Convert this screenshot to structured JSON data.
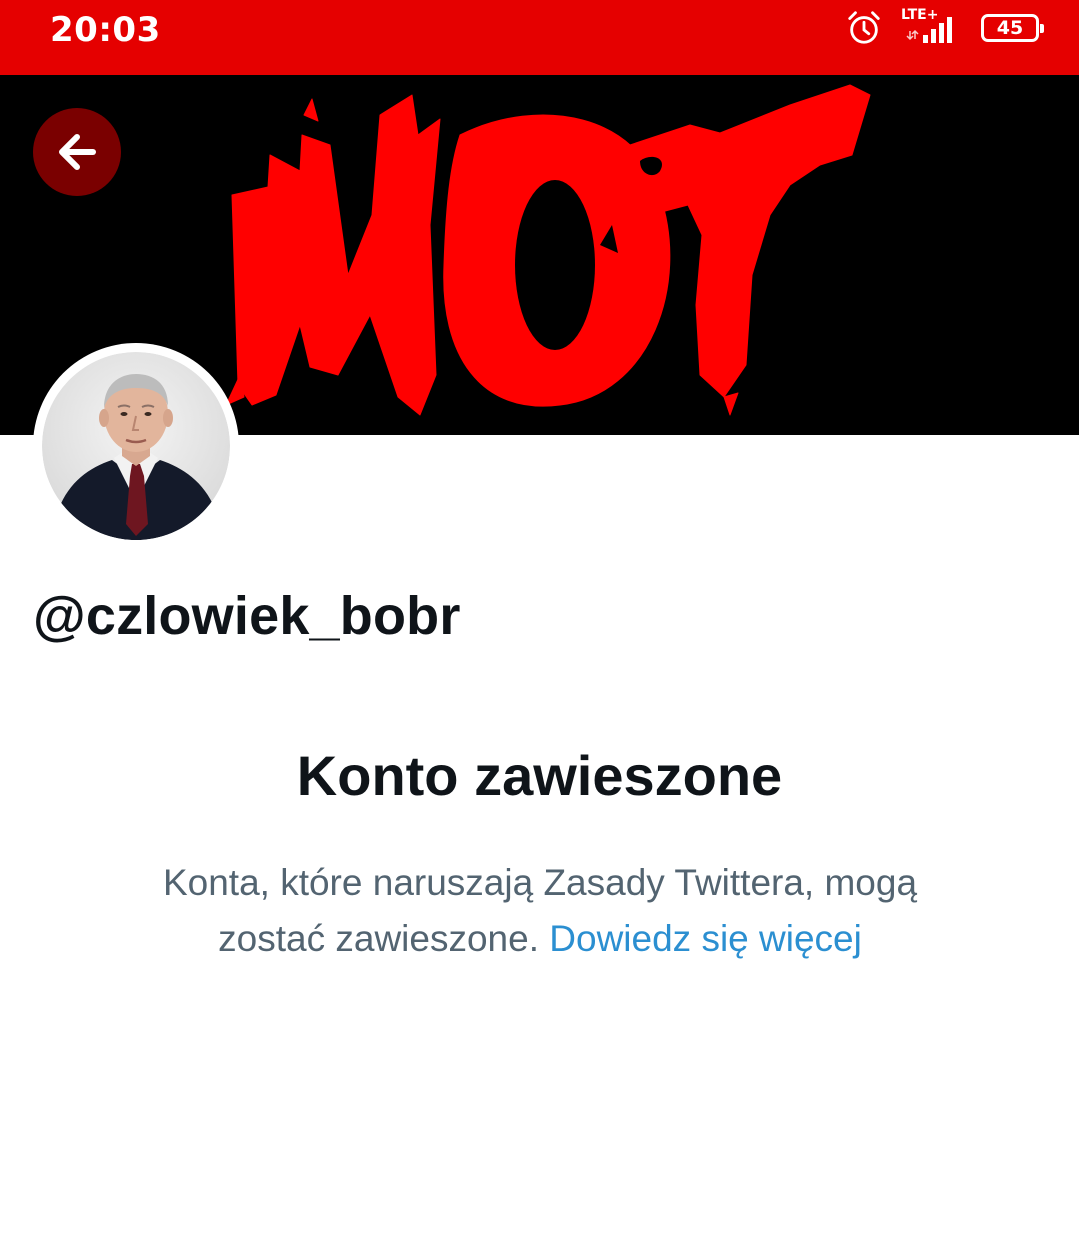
{
  "status_bar": {
    "time": "20:03",
    "network_type": "LTE+",
    "battery_level": "45",
    "background_color": "#e50000",
    "icons": [
      "alarm-icon",
      "signal-icon",
      "battery-icon"
    ]
  },
  "header": {
    "back_icon": "arrow-left-icon",
    "banner_text": "NOT",
    "banner_colors": {
      "background": "#000000",
      "text": "#ff0000"
    }
  },
  "profile": {
    "handle": "@czlowiek_bobr"
  },
  "suspension": {
    "title": "Konto zawieszone",
    "message": "Konta, które naruszają Zasady Twittera, mogą zostać zawieszone.",
    "learn_more_label": "Dowiedz się więcej",
    "link_color": "#2b8fd1"
  }
}
